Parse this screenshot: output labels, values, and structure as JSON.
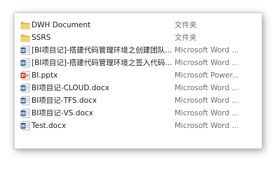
{
  "files": [
    {
      "name": "DWH Document",
      "type": "文件夹",
      "icon": "folder-icon"
    },
    {
      "name": "SSRS",
      "type": "文件夹",
      "icon": "folder-icon"
    },
    {
      "name": "[BI项目记]-搭建代码管理环境之创建团队...",
      "type": "Microsoft Word ...",
      "icon": "word-document-icon"
    },
    {
      "name": "[BI项目记]-搭建代码管理环境之签入代码...",
      "type": "Microsoft Word ...",
      "icon": "word-document-icon"
    },
    {
      "name": "BI.pptx",
      "type": "Microsoft Power...",
      "icon": "powerpoint-document-icon"
    },
    {
      "name": "BI项目记-CLOUD.docx",
      "type": "Microsoft Word ...",
      "icon": "word-document-icon"
    },
    {
      "name": "BI项目记-TFS.docx",
      "type": "Microsoft Word ...",
      "icon": "word-document-icon"
    },
    {
      "name": "BI项目记-VS.docx",
      "type": "Microsoft Word ...",
      "icon": "word-document-icon"
    },
    {
      "name": "Test.docx",
      "type": "Microsoft Word ...",
      "icon": "word-document-icon"
    }
  ]
}
